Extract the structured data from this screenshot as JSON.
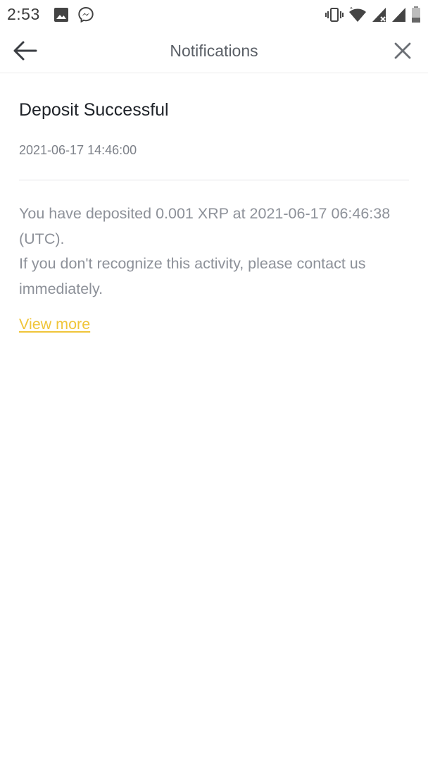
{
  "status_bar": {
    "time": "2:53",
    "left_icons": [
      "image-icon",
      "messenger-icon"
    ],
    "right_icons": [
      "vibrate-icon",
      "wifi-icon",
      "signal-x-icon",
      "signal-icon",
      "battery-icon"
    ]
  },
  "app_bar": {
    "title": "Notifications",
    "back_icon": "arrow-left-icon",
    "close_icon": "close-icon"
  },
  "notification": {
    "title": "Deposit Successful",
    "timestamp": "2021-06-17 14:46:00",
    "body_line1": "You have deposited 0.001 XRP at 2021-06-17 06:46:38 (UTC).",
    "body_line2": "If you don't recognize this activity, please contact us immediately.",
    "view_more": "View more"
  },
  "colors": {
    "accent": "#f0c53a",
    "title_text": "#1f2329",
    "body_text": "#8d9199",
    "meta_text": "#7d8189"
  }
}
